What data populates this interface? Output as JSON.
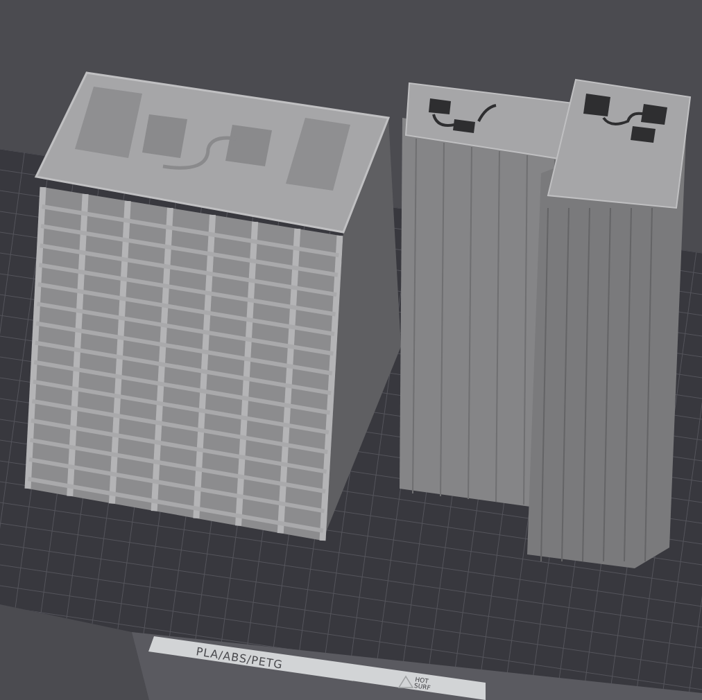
{
  "viewport": {
    "bed_label": {
      "material": "PLA/ABS/PETG",
      "warning": [
        "HOT",
        "SURF"
      ]
    }
  }
}
